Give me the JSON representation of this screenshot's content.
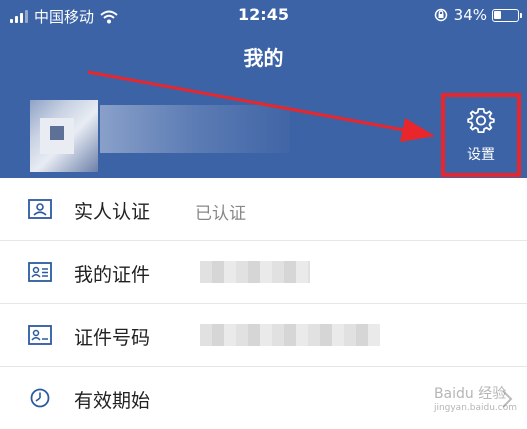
{
  "status_bar": {
    "carrier": "中国移动",
    "time": "12:45",
    "battery": "34%",
    "battery_level": 0.34
  },
  "header": {
    "title": "我的"
  },
  "settings": {
    "label": "设置"
  },
  "list": {
    "items": [
      {
        "label": "实人认证",
        "value": "已认证",
        "icon": "id-card-icon"
      },
      {
        "label": "我的证件",
        "value": "",
        "icon": "license-icon"
      },
      {
        "label": "证件号码",
        "value": "",
        "icon": "id-number-icon"
      },
      {
        "label": "有效期始",
        "value": "",
        "icon": "clock-icon"
      }
    ]
  },
  "watermark": {
    "text": "Baidu 经验",
    "url": "jingyan.baidu.com"
  },
  "colors": {
    "header_bg": "#3c63a6",
    "highlight": "#e8262b",
    "icon_blue": "#2c5aa0"
  }
}
